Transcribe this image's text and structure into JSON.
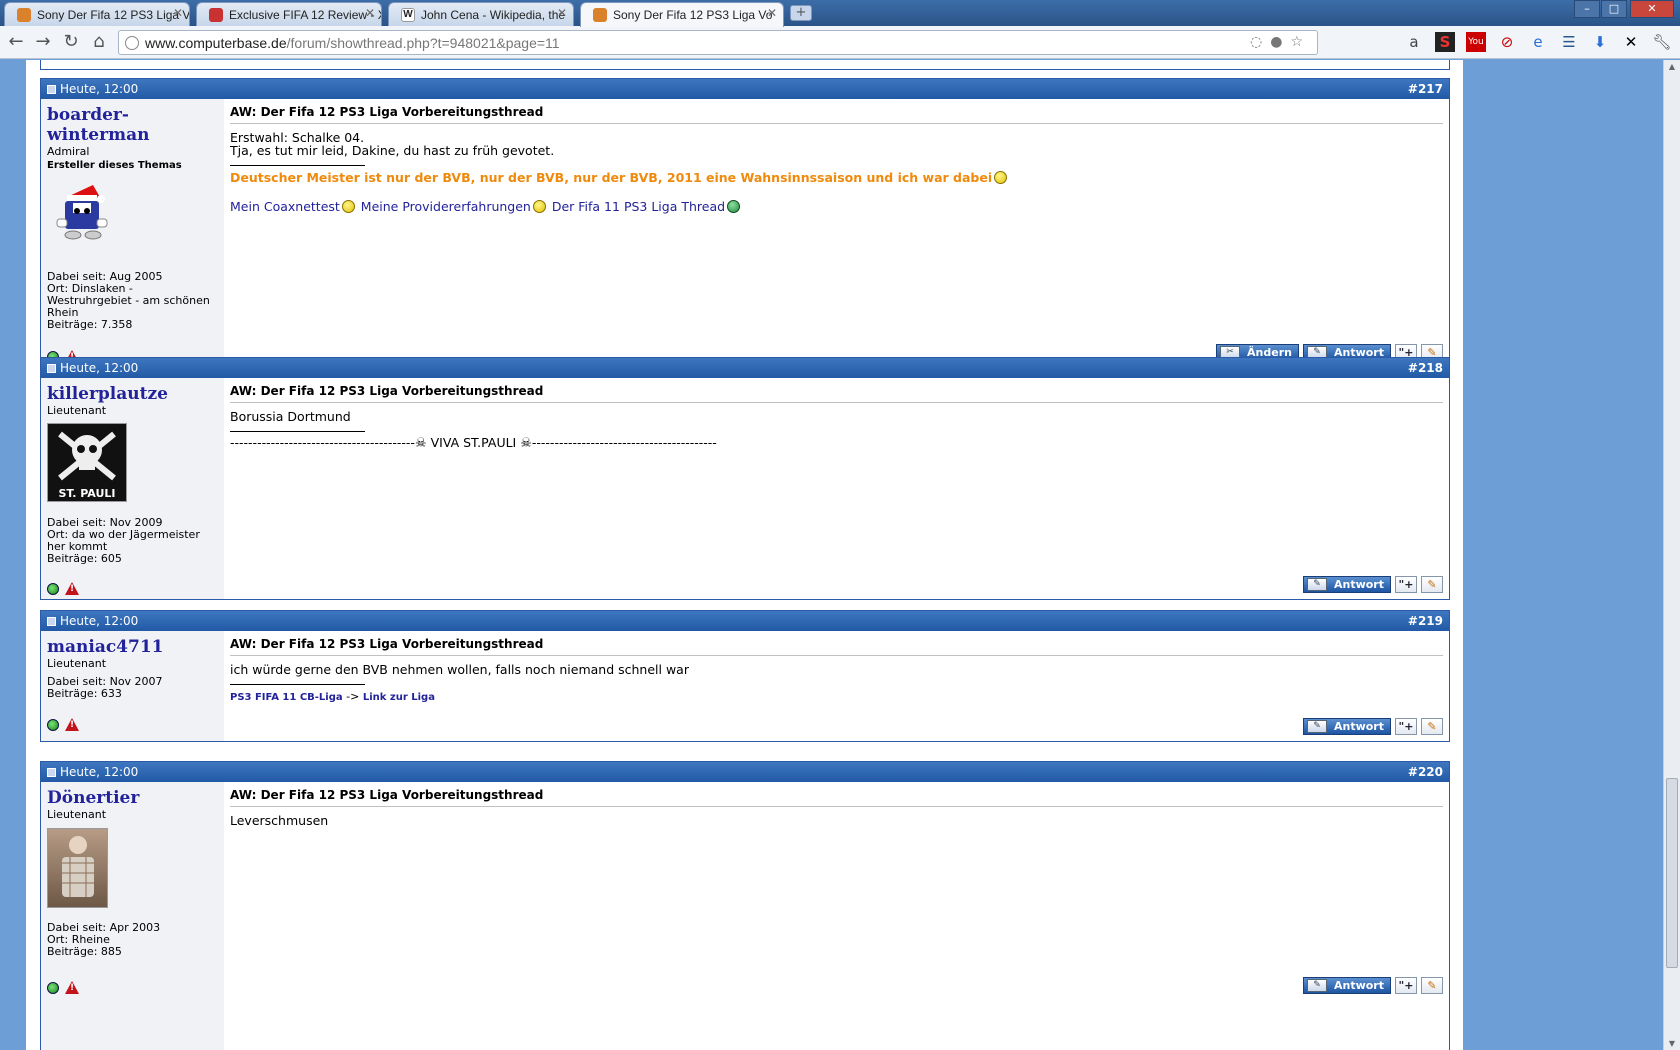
{
  "browser": {
    "tabs": [
      {
        "title": "Sony Der Fifa 12 PS3 Liga Vo",
        "favicon_color": "#d9822b"
      },
      {
        "title": "Exclusive FIFA 12 Review - X",
        "favicon_color": "#c83232"
      },
      {
        "title": "John Cena - Wikipedia, the",
        "favicon_color": "#ffffff"
      },
      {
        "title": "Sony Der Fifa 12 PS3 Liga Vo",
        "favicon_color": "#d9822b"
      }
    ],
    "url_host": "www.computerbase.de",
    "url_path": "/forum/showthread.php?t=948021&page=11"
  },
  "posts": [
    {
      "date": "Heute, 12:00",
      "number": "#217",
      "username": "boarder-winterman",
      "rank": "Admiral",
      "starter": "Ersteller dieses Themas",
      "joined": "Dabei seit: Aug 2005",
      "location": "Ort: Dinslaken - Westruhrgebiet - am schönen Rhein",
      "posts": "Beiträge: 7.358",
      "title": "AW: Der Fifa 12 PS3 Liga Vorbereitungsthread",
      "line1": "Erstwahl: Schalke 04.",
      "line2": "Tja, es tut mir leid, Dakine, du hast zu früh gevotet.",
      "signature": "Deutscher Meister ist nur der BVB, nur der BVB, nur der BVB, 2011 eine Wahnsinnssaison und ich war dabei",
      "link1": "Mein Coaxnettest",
      "link2": "Meine Providererfahrungen",
      "link3": "Der Fifa 11 PS3 Liga Thread",
      "edit_label": "Ändern",
      "reply_label": "Antwort"
    },
    {
      "date": "Heute, 12:00",
      "number": "#218",
      "username": "killerplautze",
      "rank": "Lieutenant",
      "avatar_text": "ST. PAULI",
      "joined": "Dabei seit: Nov 2009",
      "location": "Ort: da wo der Jägermeister her kommt",
      "posts": "Beiträge: 605",
      "title": "AW: Der Fifa 12 PS3 Liga Vorbereitungsthread",
      "line1": "Borussia Dortmund",
      "sig_left": "-----------------------------------------",
      "sig_mid": "VIVA ST.PAULI",
      "sig_right": "-----------------------------------------",
      "reply_label": "Antwort"
    },
    {
      "date": "Heute, 12:00",
      "number": "#219",
      "username": "maniac4711",
      "rank": "Lieutenant",
      "joined": "Dabei seit: Nov 2007",
      "posts": "Beiträge: 633",
      "title": "AW: Der Fifa 12 PS3 Liga Vorbereitungsthread",
      "line1": "ich würde gerne den BVB nehmen wollen, falls noch niemand schnell war",
      "sig_link1": "PS3 FIFA 11 CB-Liga",
      "sig_arrow": " -> ",
      "sig_link2": "Link zur Liga",
      "reply_label": "Antwort"
    },
    {
      "date": "Heute, 12:00",
      "number": "#220",
      "username": "Dönertier",
      "rank": "Lieutenant",
      "joined": "Dabei seit: Apr 2003",
      "location": "Ort: Rheine",
      "posts": "Beiträge: 885",
      "title": "AW: Der Fifa 12 PS3 Liga Vorbereitungsthread",
      "line1": "Leverschmusen",
      "reply_label": "Antwort"
    }
  ]
}
